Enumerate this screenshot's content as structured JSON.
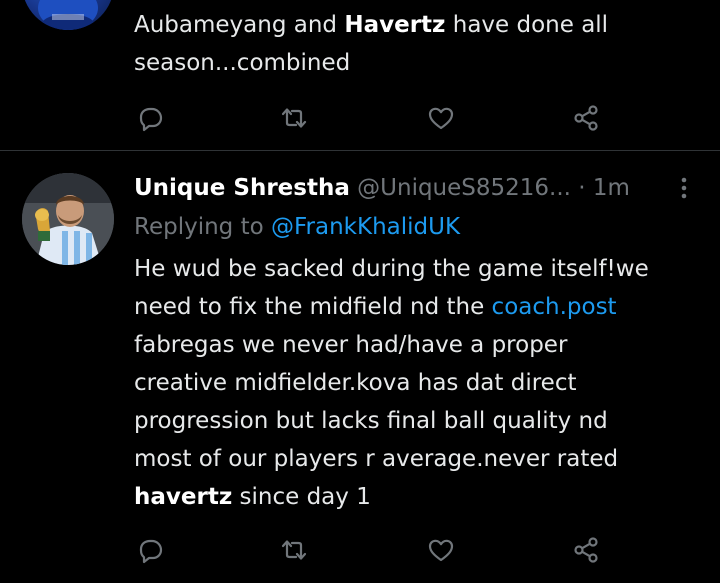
{
  "colors": {
    "background": "#000000",
    "text": "#e7e9ea",
    "muted": "#71767b",
    "link": "#1d9bf0",
    "divider": "#2f3336"
  },
  "tweets": [
    {
      "body_segments": [
        {
          "text": "Aubameyang and ",
          "style": "normal"
        },
        {
          "text": "Havertz",
          "style": "bold"
        },
        {
          "text": " have done all\nseason...combined",
          "style": "normal"
        }
      ],
      "actions": {
        "reply_icon": "reply-icon",
        "retweet_icon": "retweet-icon",
        "like_icon": "heart-icon",
        "share_icon": "share-icon"
      }
    },
    {
      "author": {
        "name": "Unique Shrestha",
        "handle": "@UniqueS85216...",
        "time": "· 1m",
        "avatar_icon": "avatar"
      },
      "replying_prefix": "Replying to ",
      "replying_to": "@FrankKhalidUK",
      "body_segments": [
        {
          "text": "He wud be sacked during the game itself!we\nneed to fix the midfield nd the ",
          "style": "normal"
        },
        {
          "text": "coach.post",
          "style": "link"
        },
        {
          "text": "\nfabregas we never had/have a proper\ncreative midfielder.kova has dat direct\nprogression but lacks final ball quality nd\nmost of our players r average.never rated\n",
          "style": "normal"
        },
        {
          "text": "havertz",
          "style": "bold"
        },
        {
          "text": " since day 1",
          "style": "normal"
        }
      ],
      "actions": {
        "reply_icon": "reply-icon",
        "retweet_icon": "retweet-icon",
        "like_icon": "heart-icon",
        "share_icon": "share-icon"
      }
    }
  ]
}
